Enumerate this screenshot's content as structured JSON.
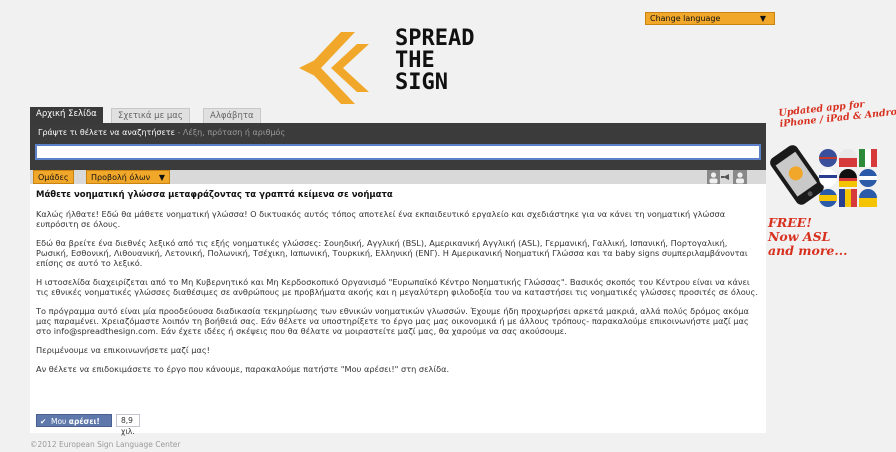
{
  "language_selector": {
    "label": "Change language",
    "arrow": "▼"
  },
  "logo": {
    "line1": "SPREAD",
    "line2": "THE",
    "line3": "SIGN",
    "mark_color": "#f1a82a"
  },
  "tabs": [
    {
      "label": "Αρχική Σελίδα",
      "active": true
    },
    {
      "label": "Σχετικά με μας",
      "active": false
    },
    {
      "label": "Αλφάβητα",
      "active": false
    }
  ],
  "search": {
    "prompt": "Γράψτε τι θέλετε να αναζητήσετε",
    "hint": " - Λέξη, πρόταση ή αριθμός",
    "value": ""
  },
  "toolbar": {
    "groups_label": "Ομάδες",
    "show_all_label": "Προβολή όλων",
    "arrow": "▼"
  },
  "content": {
    "heading": "Μάθετε νοηματική γλώσσα μεταφράζοντας τα γραπτά κείμενα σε νοήματα",
    "paragraphs": [
      "Καλώς ήλθατε! Εδώ θα μάθετε νοηματική γλώσσα! Ο δικτυακός αυτός τόπος αποτελεί ένα εκπαιδευτικό εργαλείο και σχεδιάστηκε για να κάνει τη νοηματική γλώσσα ευπρόσιτη σε όλους.",
      "Εδώ θα βρείτε ένα διεθνές λεξικό από τις εξής νοηματικές γλώσσες: Σουηδική, Αγγλική (BSL), Αμερικανική Αγγλική (ASL), Γερμανική, Γαλλική, Ισπανική, Πορτογαλική, Ρωσική, Εσθονική, Λιθουανική, Λετονική, Πολωνική, Τσέχικη, Ιαπωνική, Τουρκική, Ελληνική (ΕΝΓ). Η Αμερικανική Νοηματική Γλώσσα και τα baby signs συμπεριλαμβάνονται επίσης σε αυτό το λεξικό.",
      "Η ιστοσελίδα διαχειρίζεται από το Μη Κυβερνητικό και Μη Κερδοσκοπικό Οργανισμό \"Ευρωπαϊκό Κέντρο Νοηματικής Γλώσσας\". Βασικός σκοπός του Κέντρου είναι να κάνει τις εθνικές νοηματικές γλώσσες διαθέσιμες σε ανθρώπους με προβλήματα ακοής και η μεγαλύτερη φιλοδοξία του να καταστήσει τις νοηματικές γλώσσες προσιτές σε όλους.",
      "Το πρόγραμμα αυτό είναι μία προοδεύουσα διαδικασία τεκμηρίωσης των εθνικών νοηματικών γλωσσών. Έχουμε ήδη προχωρήσει αρκετά μακριά, αλλά πολύς δρόμος ακόμα μας παραμένει. Χρειαζόμαστε λοιπόν τη βοήθειά σας. Εάν θέλετε να υποστηρίξετε το έργο μας μας οικονομικά ή με άλλους τρόπους- παρακαλούμε επικοινωνήστε μαζί μας στο info@spreadthesign.com. Εάν έχετε ιδέες ή σκέψεις που θα θέλατε να μοιραστείτε μαζί μας, θα χαρούμε να σας ακούσουμε.",
      "Περιμένουμε να επικοινωνήσετε μαζί μας!",
      "Αν θέλετε να επιδοκιμάσετε το έργο που κάνουμε, παρακαλούμε πατήστε \"Μου αρέσει!\" στη σελίδα."
    ]
  },
  "like": {
    "label_start": "Μου ",
    "label_strong": "αρέσει!",
    "count": "8,9 χιλ."
  },
  "footer": {
    "text": "©2012 European Sign Language Center"
  },
  "promo": {
    "updated_line1": "Updated app for",
    "updated_line2": "iPhone / iPad & Android",
    "free_line1": "FREE!",
    "free_line2": "Now ASL",
    "free_line3": "and more..."
  }
}
